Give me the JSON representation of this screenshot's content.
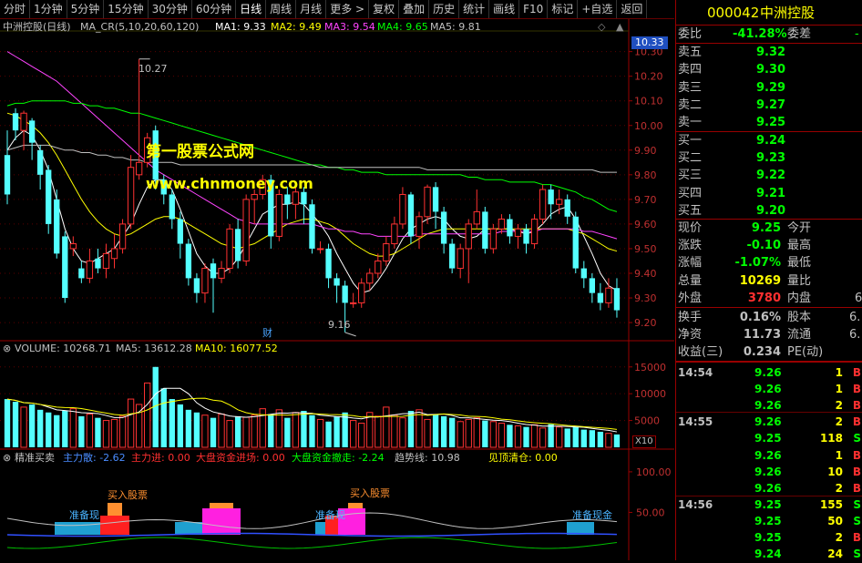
{
  "toolbar": {
    "items": [
      "分时",
      "1分钟",
      "5分钟",
      "15分钟",
      "30分钟",
      "60分钟",
      "日线",
      "周线",
      "月线",
      "更多 >",
      "复权",
      "叠加",
      "历史",
      "统计",
      "画线",
      "F10",
      "标记",
      "+自选",
      "返回"
    ],
    "active_index": 6
  },
  "main_chart": {
    "header": {
      "name": "中洲控股(日线)",
      "indicator": "MA_CR(5,10,20,60,120)",
      "ma1": "MA1: 9.33",
      "ma2": "MA2: 9.49",
      "ma3": "MA3: 9.54",
      "ma4": "MA4: 9.65",
      "ma5": "MA5: 9.81"
    },
    "annotations": {
      "high": "10.27",
      "low": "9.16",
      "cai": "财"
    },
    "watermark": {
      "line1": "第一股票公式网",
      "line2": "www.chnmoney.com"
    },
    "y_ticks": [
      "10.30",
      "10.20",
      "10.10",
      "10.00",
      "9.90",
      "9.80",
      "9.70",
      "9.60",
      "9.50",
      "9.40",
      "9.30",
      "9.20"
    ],
    "current_price_tag": "10.33",
    "colors": {
      "up": "#ff3232",
      "down": "#54ffff",
      "ma1": "#ffffff",
      "ma2": "#ffff00",
      "ma3": "#ff44ff",
      "ma4": "#00ff00",
      "ma5": "#c0c0c0"
    }
  },
  "volume_chart": {
    "header": {
      "volume": "VOLUME: 10268.71",
      "ma5": "MA5: 13612.28",
      "ma10": "MA10: 16077.52"
    },
    "y_ticks": [
      "15000",
      "10000",
      "5000"
    ],
    "unit": "X10"
  },
  "signal_chart": {
    "header": {
      "name": "精准买卖",
      "zhuli_san": "主力散: -2.62",
      "zhuli_jin": "主力进: 0.00",
      "dapan_jin": "大盘资金进场: 0.00",
      "dapan_san": "大盘资金撤走: -2.24",
      "qushi": "趋势线: 10.98",
      "jianding": "见顶清仓: 0.00"
    },
    "labels": {
      "buy": "买入股票",
      "prepare": "准备现金",
      "prepare_short": "准备现"
    },
    "y_ticks": [
      "100.00",
      "50.00"
    ]
  },
  "chart_data": [
    {
      "type": "candlestick",
      "title": "中洲控股(日线)",
      "ylim": [
        9.13,
        10.38
      ],
      "series_order": [
        "open",
        "close",
        "high",
        "low"
      ],
      "candles": [
        [
          9.88,
          9.72,
          9.98,
          9.68
        ],
        [
          10.05,
          9.98,
          10.07,
          9.94
        ],
        [
          9.98,
          10.05,
          10.06,
          9.9
        ],
        [
          10.02,
          9.93,
          10.03,
          9.86
        ],
        [
          9.9,
          9.8,
          9.92,
          9.74
        ],
        [
          9.82,
          9.6,
          9.84,
          9.56
        ],
        [
          9.7,
          9.48,
          9.74,
          9.46
        ],
        [
          9.55,
          9.3,
          9.57,
          9.28
        ],
        [
          9.5,
          9.52,
          9.55,
          9.47
        ],
        [
          9.42,
          9.38,
          9.45,
          9.36
        ],
        [
          9.38,
          9.45,
          9.5,
          9.36
        ],
        [
          9.46,
          9.42,
          9.5,
          9.4
        ],
        [
          9.42,
          9.48,
          9.52,
          9.38
        ],
        [
          9.46,
          9.5,
          9.56,
          9.42
        ],
        [
          9.5,
          9.6,
          9.62,
          9.48
        ],
        [
          9.6,
          9.83,
          9.88,
          9.58
        ],
        [
          9.8,
          9.85,
          10.27,
          9.78
        ],
        [
          9.85,
          9.95,
          9.97,
          9.83
        ],
        [
          9.98,
          9.78,
          10.0,
          9.74
        ],
        [
          9.78,
          9.72,
          9.8,
          9.68
        ],
        [
          9.72,
          9.62,
          9.74,
          9.58
        ],
        [
          9.62,
          9.52,
          9.65,
          9.46
        ],
        [
          9.52,
          9.38,
          9.54,
          9.35
        ],
        [
          9.38,
          9.32,
          9.4,
          9.28
        ],
        [
          9.32,
          9.42,
          9.44,
          9.28
        ],
        [
          9.44,
          9.38,
          9.46,
          9.24
        ],
        [
          9.38,
          9.42,
          9.45,
          9.36
        ],
        [
          9.42,
          9.58,
          9.6,
          9.4
        ],
        [
          9.58,
          9.45,
          9.62,
          9.42
        ],
        [
          9.45,
          9.7,
          9.72,
          9.43
        ],
        [
          9.7,
          9.72,
          9.74,
          9.6
        ],
        [
          9.72,
          9.78,
          9.8,
          9.7
        ],
        [
          9.78,
          9.55,
          9.8,
          9.5
        ],
        [
          9.55,
          9.72,
          9.74,
          9.53
        ],
        [
          9.72,
          9.68,
          9.75,
          9.62
        ],
        [
          9.68,
          9.73,
          9.76,
          9.62
        ],
        [
          9.73,
          9.68,
          9.75,
          9.6
        ],
        [
          9.68,
          9.5,
          9.7,
          9.48
        ],
        [
          9.5,
          9.5,
          9.53,
          9.48
        ],
        [
          9.5,
          9.38,
          9.52,
          9.34
        ],
        [
          9.38,
          9.35,
          9.4,
          9.28
        ],
        [
          9.35,
          9.28,
          9.37,
          9.16
        ],
        [
          9.28,
          9.28,
          9.32,
          9.26
        ],
        [
          9.28,
          9.36,
          9.38,
          9.26
        ],
        [
          9.36,
          9.4,
          9.42,
          9.33
        ],
        [
          9.4,
          9.45,
          9.48,
          9.38
        ],
        [
          9.45,
          9.52,
          9.55,
          9.43
        ],
        [
          9.52,
          9.6,
          9.63,
          9.5
        ],
        [
          9.6,
          9.72,
          9.75,
          9.58
        ],
        [
          9.72,
          9.55,
          9.73,
          9.52
        ],
        [
          9.55,
          9.63,
          9.65,
          9.5
        ],
        [
          9.63,
          9.75,
          9.76,
          9.6
        ],
        [
          9.75,
          9.65,
          9.77,
          9.58
        ],
        [
          9.65,
          9.52,
          9.67,
          9.48
        ],
        [
          9.52,
          9.42,
          9.54,
          9.4
        ],
        [
          9.42,
          9.5,
          9.52,
          9.38
        ],
        [
          9.5,
          9.6,
          9.62,
          9.36
        ],
        [
          9.6,
          9.65,
          9.74,
          9.58
        ],
        [
          9.65,
          9.5,
          9.67,
          9.48
        ],
        [
          9.5,
          9.58,
          9.6,
          9.48
        ],
        [
          9.58,
          9.62,
          9.64,
          9.56
        ],
        [
          9.62,
          9.55,
          9.64,
          9.52
        ],
        [
          9.55,
          9.58,
          9.6,
          9.5
        ],
        [
          9.58,
          9.52,
          9.6,
          9.48
        ],
        [
          9.52,
          9.62,
          9.64,
          9.5
        ],
        [
          9.62,
          9.74,
          9.76,
          9.6
        ],
        [
          9.74,
          9.68,
          9.76,
          9.62
        ],
        [
          9.68,
          9.7,
          9.74,
          9.64
        ],
        [
          9.7,
          9.63,
          9.72,
          9.6
        ],
        [
          9.63,
          9.42,
          9.65,
          9.4
        ],
        [
          9.42,
          9.38,
          9.45,
          9.34
        ],
        [
          9.38,
          9.32,
          9.4,
          9.28
        ],
        [
          9.32,
          9.28,
          9.36,
          9.25
        ],
        [
          9.28,
          9.34,
          9.38,
          9.26
        ],
        [
          9.34,
          9.25,
          9.38,
          9.22
        ]
      ],
      "moving_averages": {
        "MA1": [
          9.9,
          9.95,
          9.98,
          9.96,
          9.9,
          9.82,
          9.7,
          9.58,
          9.5,
          9.45,
          9.44,
          9.46,
          9.48,
          9.5,
          9.55,
          9.6,
          9.68,
          9.75,
          9.78,
          9.78,
          9.74,
          9.66,
          9.57,
          9.48,
          9.43,
          9.4,
          9.4,
          9.42,
          9.46,
          9.52,
          9.58,
          9.64,
          9.66,
          9.68,
          9.68,
          9.69,
          9.68,
          9.64,
          9.6,
          9.55,
          9.48,
          9.42,
          9.36,
          9.32,
          9.33,
          9.37,
          9.42,
          9.48,
          9.54,
          9.58,
          9.6,
          9.62,
          9.63,
          9.62,
          9.58,
          9.55,
          9.54,
          9.55,
          9.58,
          9.58,
          9.58,
          9.58,
          9.57,
          9.56,
          9.57,
          9.6,
          9.64,
          9.66,
          9.67,
          9.62,
          9.55,
          9.48,
          9.4,
          9.35,
          9.33
        ],
        "MA2": [
          10.05,
          10.04,
          10.02,
          10.0,
          9.97,
          9.93,
          9.88,
          9.82,
          9.76,
          9.7,
          9.65,
          9.61,
          9.58,
          9.56,
          9.55,
          9.56,
          9.58,
          9.6,
          9.62,
          9.63,
          9.63,
          9.62,
          9.6,
          9.58,
          9.56,
          9.54,
          9.52,
          9.51,
          9.5,
          9.51,
          9.52,
          9.54,
          9.56,
          9.58,
          9.6,
          9.61,
          9.62,
          9.62,
          9.61,
          9.6,
          9.58,
          9.55,
          9.52,
          9.5,
          9.48,
          9.47,
          9.47,
          9.48,
          9.5,
          9.52,
          9.54,
          9.56,
          9.57,
          9.58,
          9.58,
          9.58,
          9.58,
          9.58,
          9.58,
          9.58,
          9.58,
          9.58,
          9.58,
          9.58,
          9.58,
          9.58,
          9.58,
          9.58,
          9.58,
          9.57,
          9.56,
          9.54,
          9.52,
          9.5,
          9.49
        ],
        "MA3": [
          10.3,
          10.28,
          10.26,
          10.24,
          10.22,
          10.2,
          10.18,
          10.15,
          10.12,
          10.09,
          10.06,
          10.03,
          10.0,
          9.97,
          9.94,
          9.91,
          9.88,
          9.85,
          9.82,
          9.8,
          9.78,
          9.76,
          9.74,
          9.72,
          9.7,
          9.68,
          9.66,
          9.64,
          9.62,
          9.61,
          9.6,
          9.6,
          9.6,
          9.6,
          9.6,
          9.6,
          9.6,
          9.6,
          9.59,
          9.58,
          9.58,
          9.57,
          9.57,
          9.56,
          9.56,
          9.55,
          9.55,
          9.55,
          9.55,
          9.55,
          9.56,
          9.56,
          9.56,
          9.56,
          9.56,
          9.56,
          9.56,
          9.56,
          9.56,
          9.56,
          9.57,
          9.57,
          9.57,
          9.57,
          9.57,
          9.58,
          9.58,
          9.58,
          9.58,
          9.58,
          9.57,
          9.57,
          9.56,
          9.55,
          9.54
        ],
        "MA4": [
          10.08,
          10.09,
          10.09,
          10.1,
          10.1,
          10.1,
          10.1,
          10.1,
          10.09,
          10.09,
          10.08,
          10.08,
          10.07,
          10.07,
          10.06,
          10.05,
          10.05,
          10.04,
          10.03,
          10.02,
          10.01,
          10.0,
          9.99,
          9.98,
          9.97,
          9.96,
          9.95,
          9.94,
          9.93,
          9.92,
          9.91,
          9.9,
          9.89,
          9.88,
          9.87,
          9.86,
          9.85,
          9.84,
          9.84,
          9.83,
          9.83,
          9.82,
          9.82,
          9.81,
          9.81,
          9.81,
          9.8,
          9.8,
          9.8,
          9.8,
          9.8,
          9.8,
          9.8,
          9.8,
          9.8,
          9.8,
          9.79,
          9.79,
          9.78,
          9.78,
          9.78,
          9.77,
          9.77,
          9.77,
          9.77,
          9.76,
          9.76,
          9.75,
          9.74,
          9.73,
          9.71,
          9.7,
          9.68,
          9.66,
          9.65
        ],
        "MA5": [
          9.9,
          9.91,
          9.92,
          9.92,
          9.92,
          9.92,
          9.91,
          9.9,
          9.9,
          9.89,
          9.89,
          9.88,
          9.88,
          9.87,
          9.87,
          9.86,
          9.86,
          9.85,
          9.85,
          9.85,
          9.85,
          9.84,
          9.84,
          9.84,
          9.84,
          9.84,
          9.84,
          9.84,
          9.84,
          9.84,
          9.84,
          9.84,
          9.84,
          9.84,
          9.84,
          9.84,
          9.84,
          9.84,
          9.83,
          9.83,
          9.83,
          9.83,
          9.83,
          9.83,
          9.83,
          9.83,
          9.83,
          9.83,
          9.83,
          9.83,
          9.83,
          9.82,
          9.82,
          9.82,
          9.82,
          9.82,
          9.82,
          9.82,
          9.82,
          9.82,
          9.82,
          9.82,
          9.82,
          9.82,
          9.82,
          9.82,
          9.82,
          9.82,
          9.82,
          9.82,
          9.82,
          9.82,
          9.81,
          9.81,
          9.81
        ]
      }
    },
    {
      "type": "bar",
      "title": "VOLUME",
      "ylim": [
        0,
        17000
      ],
      "values": [
        9000,
        8500,
        7500,
        8000,
        7000,
        6500,
        6000,
        6800,
        7200,
        5800,
        6200,
        5500,
        5000,
        5200,
        5800,
        9000,
        8000,
        12000,
        15000,
        11000,
        9000,
        8000,
        7000,
        6500,
        6000,
        5500,
        6200,
        5000,
        5800,
        5600,
        6000,
        7200,
        6200,
        7000,
        5500,
        6500,
        6800,
        6000,
        5200,
        4800,
        5800,
        6500,
        5000,
        4500,
        6500,
        5800,
        7500,
        6000,
        5500,
        6800,
        7000,
        5200,
        6200,
        5800,
        5500,
        4800,
        5200,
        5500,
        5000,
        4800,
        4500,
        4200,
        4000,
        3800,
        4200,
        3600,
        4300,
        3800,
        3500,
        3800,
        3300,
        3200,
        2900,
        2600,
        2400
      ],
      "colors_up_down": true
    }
  ],
  "right_panel": {
    "code": "000042",
    "name": "中洲控股",
    "weibi_label": "委比",
    "weibi_value": "-41.28%",
    "weicha_label": "委差",
    "weicha_value": "-",
    "asks": [
      {
        "label": "卖五",
        "price": "9.32"
      },
      {
        "label": "卖四",
        "price": "9.30"
      },
      {
        "label": "卖三",
        "price": "9.29"
      },
      {
        "label": "卖二",
        "price": "9.27"
      },
      {
        "label": "卖一",
        "price": "9.25"
      }
    ],
    "bids": [
      {
        "label": "买一",
        "price": "9.24"
      },
      {
        "label": "买二",
        "price": "9.23"
      },
      {
        "label": "买三",
        "price": "9.22"
      },
      {
        "label": "买四",
        "price": "9.21"
      },
      {
        "label": "买五",
        "price": "9.20"
      }
    ],
    "stats": [
      {
        "l1": "现价",
        "v1": "9.25",
        "l2": "今开",
        "v2": ""
      },
      {
        "l1": "涨跌",
        "v1": "-0.10",
        "l2": "最高",
        "v2": ""
      },
      {
        "l1": "涨幅",
        "v1": "-1.07%",
        "l2": "最低",
        "v2": ""
      },
      {
        "l1": "总量",
        "v1": "10269",
        "l2": "量比",
        "v2": ""
      },
      {
        "l1": "外盘",
        "v1": "3780",
        "l2": "内盘",
        "v2": "6"
      }
    ],
    "stats2": [
      {
        "l1": "换手",
        "v1": "0.16%",
        "l2": "股本",
        "v2": "6."
      },
      {
        "l1": "净资",
        "v1": "11.73",
        "l2": "流通",
        "v2": "6."
      },
      {
        "l1": "收益(三)",
        "v1": "0.234",
        "l2": "PE(动)",
        "v2": ""
      }
    ],
    "ticks": [
      {
        "time": "14:54",
        "price": "9.26",
        "vol": "1",
        "bs": "B"
      },
      {
        "time": "",
        "price": "9.26",
        "vol": "1",
        "bs": "B"
      },
      {
        "time": "",
        "price": "9.26",
        "vol": "2",
        "bs": "B"
      },
      {
        "time": "14:55",
        "price": "9.26",
        "vol": "2",
        "bs": "B"
      },
      {
        "time": "",
        "price": "9.25",
        "vol": "118",
        "bs": "S"
      },
      {
        "time": "",
        "price": "9.26",
        "vol": "1",
        "bs": "B"
      },
      {
        "time": "",
        "price": "9.26",
        "vol": "10",
        "bs": "B"
      },
      {
        "time": "",
        "price": "9.26",
        "vol": "2",
        "bs": "B"
      },
      {
        "time": "14:56",
        "price": "9.25",
        "vol": "155",
        "bs": "S"
      },
      {
        "time": "",
        "price": "9.25",
        "vol": "50",
        "bs": "S"
      },
      {
        "time": "",
        "price": "9.25",
        "vol": "2",
        "bs": "B"
      },
      {
        "time": "",
        "price": "9.24",
        "vol": "24",
        "bs": "S"
      }
    ]
  }
}
